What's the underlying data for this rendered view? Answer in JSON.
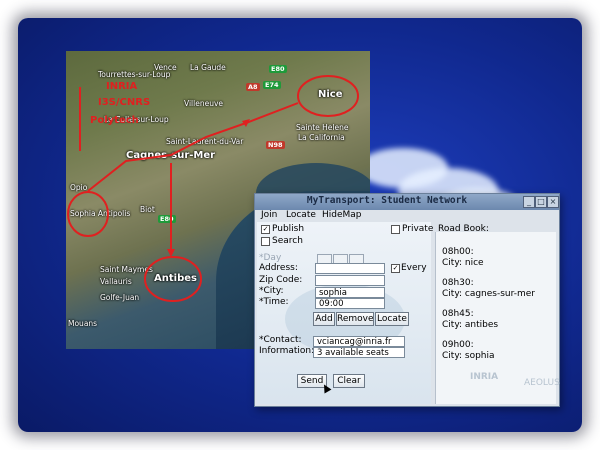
{
  "window": {
    "title": "MyTransport: Student Network",
    "buttons": [
      "_",
      "□",
      "×"
    ]
  },
  "menu": [
    "Join",
    "Locate",
    "HideMap"
  ],
  "form": {
    "publish_label": "Publish",
    "publish_checked": true,
    "search_label": "Search",
    "search_checked": false,
    "private_label": "Private",
    "private_checked": false,
    "day_label": "*Day",
    "every_label": "Every",
    "every_checked": true,
    "address_label": "Address:",
    "address_value": "",
    "zip_label": "Zip Code:",
    "zip_value": "",
    "city_label": "*City:",
    "city_value": "sophia",
    "time_label": "*Time:",
    "time_value": "09:00",
    "add_label": "Add",
    "remove_label": "Remove",
    "locate_label": "Locate",
    "contact_label": "*Contact:",
    "contact_value": "vciancag@inria.fr",
    "information_label": "Information:",
    "information_value": "3 available seats",
    "send_label": "Send",
    "clear_label": "Clear"
  },
  "roadbook": {
    "title": "Road Book:",
    "entries": [
      {
        "time": "08h00:",
        "city": "City: nice"
      },
      {
        "time": "08h30:",
        "city": "City: cagnes-sur-mer"
      },
      {
        "time": "08h45:",
        "city": "City: antibes"
      },
      {
        "time": "09h00:",
        "city": "City: sophia"
      }
    ],
    "logo_left": "INRIA",
    "logo_right": "AEOLUS"
  },
  "map": {
    "labels": {
      "vence": "Vence",
      "la_gaude": "La Gaude",
      "tourrettes": "Tourrettes-sur-Loup",
      "colle": "La Colle-sur-Loup",
      "saint_laurent": "Saint-Laurent-du-Var",
      "cagnes": "Cagnes-sur-Mer",
      "nice": "Nice",
      "antibes": "Antibes",
      "biot": "Biot",
      "sophia": "Sophia Antipolis",
      "vallauris": "Vallauris",
      "saint_maymes": "Saint Maymes",
      "golfe": "Golfe-Juan",
      "la_california": "La California",
      "sainte_helene": "Sainte Helene",
      "villeneuve": "Villeneuve",
      "opio": "Opio",
      "mouans": "Mouans"
    },
    "red_labels": [
      "INRIA",
      "I3S/CNRS",
      "Polytech"
    ],
    "roads": [
      "E80",
      "E74",
      "A8",
      "N98",
      "E80"
    ],
    "route_color": "#e02020"
  }
}
